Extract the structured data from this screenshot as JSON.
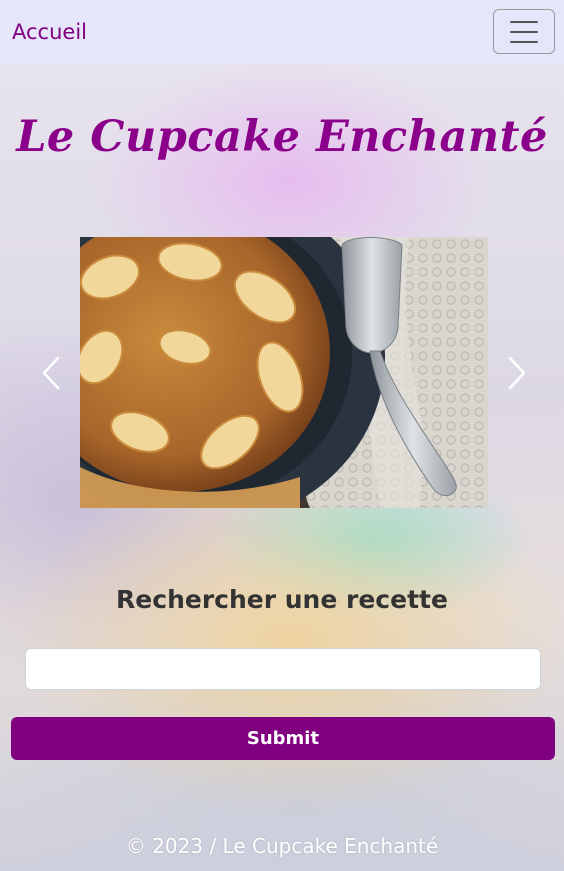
{
  "navbar": {
    "brand": "Accueil",
    "toggle_icon": "hamburger-menu-icon"
  },
  "hero": {
    "title": "Le Cupcake Enchanté"
  },
  "carousel": {
    "prev_icon": "chevron-left-icon",
    "next_icon": "chevron-right-icon",
    "prev_glyph": "‹",
    "next_glyph": "›"
  },
  "search": {
    "heading": "Rechercher une recette",
    "input_value": "",
    "input_placeholder": "",
    "submit_label": "Submit"
  },
  "footer": {
    "text": "© 2023 / Le Cupcake Enchanté"
  },
  "colors": {
    "brand": "#800080",
    "navbar_bg": "#e6e6fa",
    "title": "#8b008b",
    "button_bg": "#800080"
  }
}
